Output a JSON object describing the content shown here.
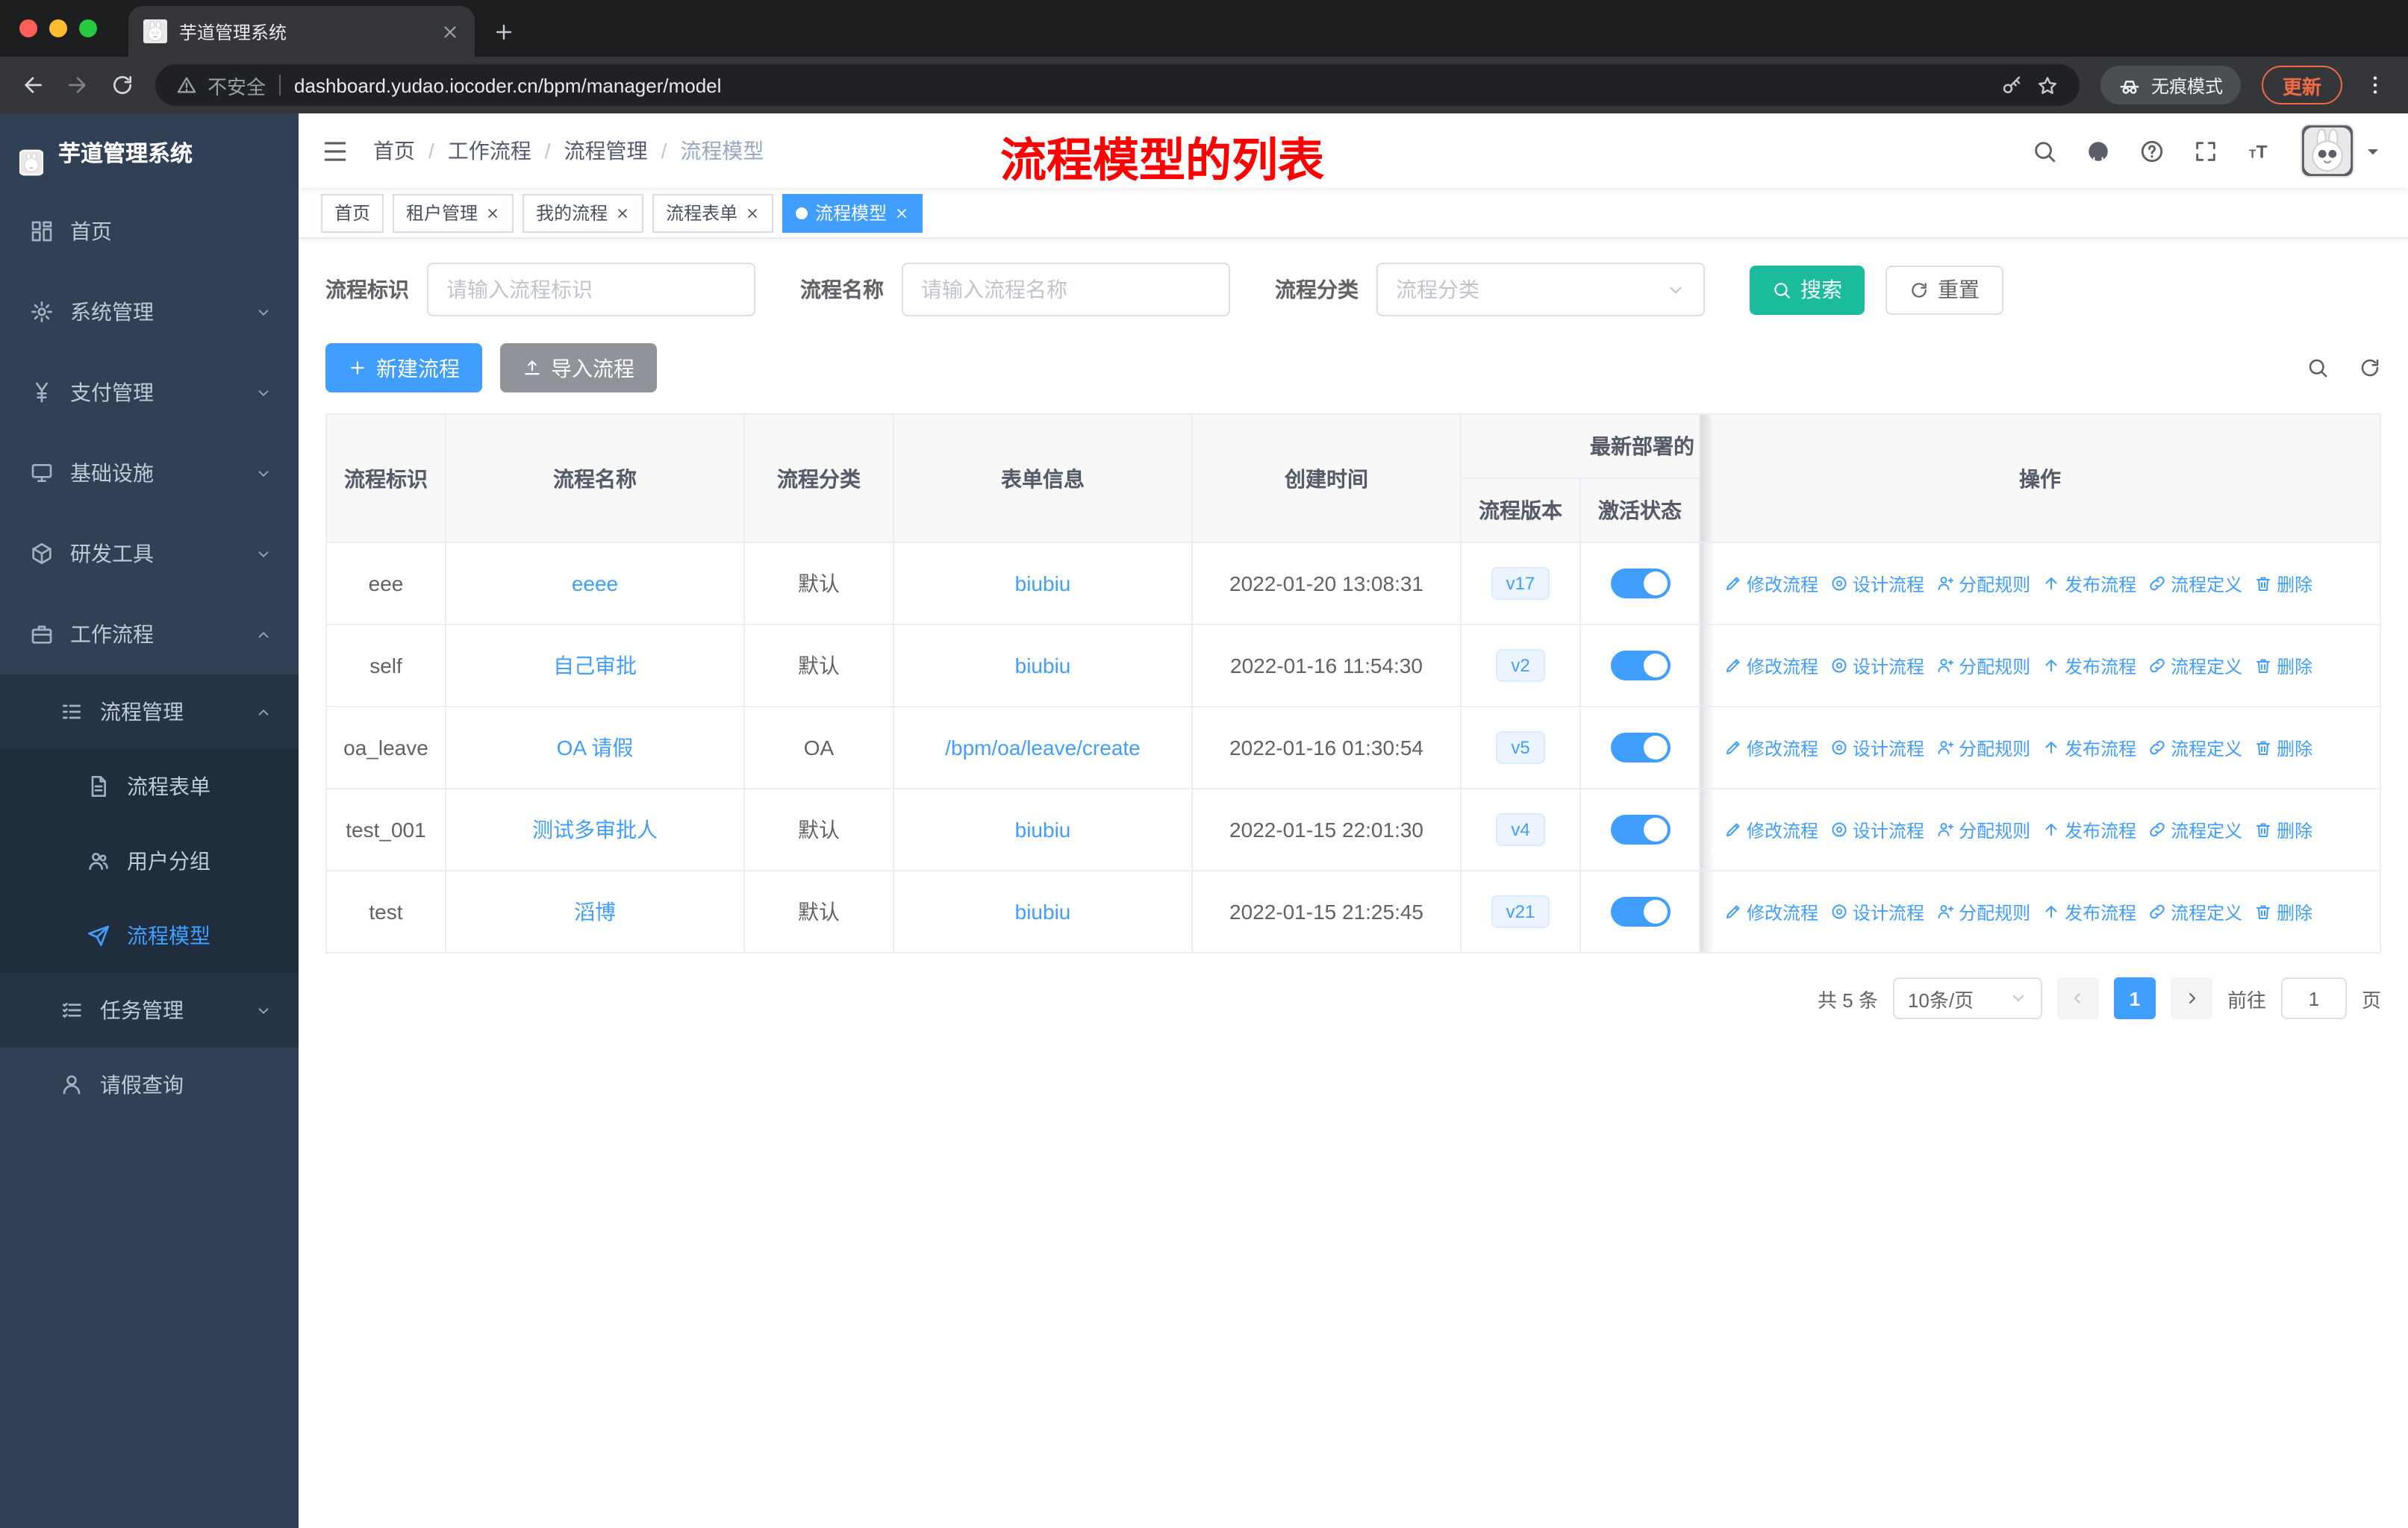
{
  "colors": {
    "accent": "#409EFF",
    "link": "#409EFF",
    "search-button": "#1ABC9C",
    "annotation": "#FF0000",
    "sidebar-bg": "#304156",
    "sidebar-sub-bg": "#1F2D3D",
    "tag-active": "#409EFF",
    "update-chip": "#ED6A45"
  },
  "browser": {
    "tab_title": "芋道管理系统",
    "security_label": "不安全",
    "url": "dashboard.yudao.iocoder.cn/bpm/manager/model",
    "incognito_label": "无痕模式",
    "update_label": "更新"
  },
  "sidebar": {
    "logo_title": "芋道管理系统",
    "menu": [
      {
        "name": "home",
        "label": "首页",
        "icon": "dashboard",
        "level": 0
      },
      {
        "name": "system-management",
        "label": "系统管理",
        "icon": "gear",
        "level": 0,
        "chevron": "down"
      },
      {
        "name": "payment-management",
        "label": "支付管理",
        "icon": "yen",
        "level": 0,
        "chevron": "down"
      },
      {
        "name": "infrastructure",
        "label": "基础设施",
        "icon": "monitor",
        "level": 0,
        "chevron": "down"
      },
      {
        "name": "dev-tools",
        "label": "研发工具",
        "icon": "toolbox",
        "level": 0,
        "chevron": "down"
      },
      {
        "name": "workflow",
        "label": "工作流程",
        "icon": "briefcase",
        "level": 0,
        "chevron": "up"
      },
      {
        "name": "process-management",
        "label": "流程管理",
        "icon": "list-tree",
        "level": 1,
        "chevron": "up",
        "bg": "sub1"
      },
      {
        "name": "process-form",
        "label": "流程表单",
        "icon": "document",
        "level": 2,
        "bg": "sub2"
      },
      {
        "name": "user-group",
        "label": "用户分组",
        "icon": "users",
        "level": 2,
        "bg": "sub2"
      },
      {
        "name": "process-model",
        "label": "流程模型",
        "icon": "paper-plane",
        "level": 2,
        "bg": "sub2",
        "active": true
      },
      {
        "name": "task-management",
        "label": "任务管理",
        "icon": "tasks",
        "level": 1,
        "chevron": "down",
        "bg": "sub1"
      },
      {
        "name": "leave-query",
        "label": "请假查询",
        "icon": "user",
        "level": 1
      }
    ]
  },
  "navbar": {
    "breadcrumb": [
      "首页",
      "工作流程",
      "流程管理",
      "流程模型"
    ],
    "annotation": "流程模型的列表"
  },
  "tags": [
    {
      "name": "home",
      "label": "首页"
    },
    {
      "name": "tenant-management",
      "label": "租户管理",
      "closable": true
    },
    {
      "name": "my-process",
      "label": "我的流程",
      "closable": true
    },
    {
      "name": "process-form",
      "label": "流程表单",
      "closable": true
    },
    {
      "name": "process-model",
      "label": "流程模型",
      "closable": true,
      "active": true
    }
  ],
  "filters": {
    "key_label": "流程标识",
    "key_placeholder": "请输入流程标识",
    "name_label": "流程名称",
    "name_placeholder": "请输入流程名称",
    "category_label": "流程分类",
    "category_placeholder": "流程分类",
    "search_label": "搜索",
    "reset_label": "重置"
  },
  "toolbar": {
    "create_label": "新建流程",
    "import_label": "导入流程"
  },
  "table": {
    "headers": [
      "流程标识",
      "流程名称",
      "流程分类",
      "表单信息",
      "创建时间"
    ],
    "group_header": "最新部署的",
    "sub_headers": [
      "流程版本",
      "激活状态"
    ],
    "op_header": "操作",
    "actions": [
      {
        "name": "edit-process",
        "label": "修改流程",
        "icon": "edit"
      },
      {
        "name": "design-process",
        "label": "设计流程",
        "icon": "target"
      },
      {
        "name": "assign-rules",
        "label": "分配规则",
        "icon": "user-assign"
      },
      {
        "name": "publish-process",
        "label": "发布流程",
        "icon": "publish"
      },
      {
        "name": "process-definition",
        "label": "流程定义",
        "icon": "link"
      },
      {
        "name": "delete",
        "label": "删除",
        "icon": "trash"
      }
    ],
    "rows": [
      {
        "key": "eee",
        "name": "eeee",
        "category": "默认",
        "form": "biubiu",
        "created": "2022-01-20 13:08:31",
        "version": "v17",
        "active": true
      },
      {
        "key": "self",
        "name": "自己审批",
        "category": "默认",
        "form": "biubiu",
        "created": "2022-01-16 11:54:30",
        "version": "v2",
        "active": true
      },
      {
        "key": "oa_leave",
        "name": "OA 请假",
        "category": "OA",
        "form": "/bpm/oa/leave/create",
        "created": "2022-01-16 01:30:54",
        "version": "v5",
        "active": true
      },
      {
        "key": "test_001",
        "name": "测试多审批人",
        "category": "默认",
        "form": "biubiu",
        "created": "2022-01-15 22:01:30",
        "version": "v4",
        "active": true
      },
      {
        "key": "test",
        "name": "滔博",
        "category": "默认",
        "form": "biubiu",
        "created": "2022-01-15 21:25:45",
        "version": "v21",
        "active": true
      }
    ]
  },
  "pagination": {
    "total_label": "共 5 条",
    "page_size_label": "10条/页",
    "current_page": "1",
    "goto_label": "前往",
    "goto_value": "1",
    "unit_label": "页"
  }
}
